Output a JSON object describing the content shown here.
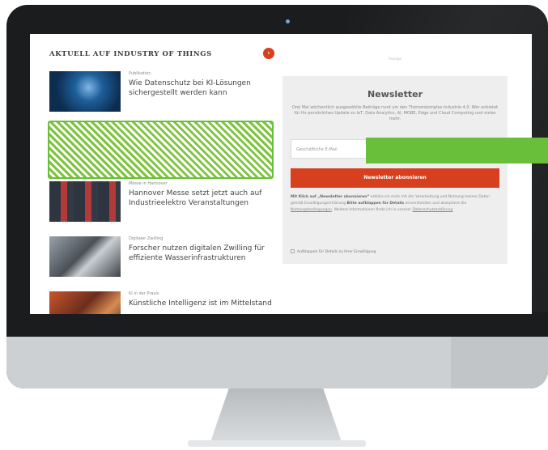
{
  "section": {
    "heading": "AKTUELL AUF INDUSTRY OF THINGS",
    "more_icon": "arrow-right-icon"
  },
  "articles": [
    {
      "category": "Publikation",
      "title": "Wie Datenschutz bei KI-Lösungen sichergestellt werden kann"
    },
    {
      "category": "Messe in Hannover",
      "title": "Hannover Messe setzt jetzt auch auf Industrieelektro Veranstaltungen"
    },
    {
      "category": "Digitaler Zwilling",
      "title": "Forscher nutzen digitalen Zwilling für effiziente Wasserinfrastrukturen"
    },
    {
      "category": "KI in der Praxis",
      "title": "Künstliche Intelligenz ist im Mittelstand"
    }
  ],
  "ad_label": "Anzeige",
  "newsletter": {
    "title": "Newsletter",
    "intro": "Drei Mal wöchentlich ausgewählte Beiträge rund um den Themenkomplex Industrie 4.0. Wer anbietet für Ihr persönliches Update zu IoT, Data Analytics, AI, MOBE, Edge und Cloud Computing und vieles mehr.",
    "email_placeholder": "Geschäftliche E-Mail",
    "subscribe_label": "Newsletter abonnieren",
    "legal_lead": "Mit Klick auf „Newsletter abonnieren“",
    "legal_body": "erkläre ich mich mit der Verarbeitung und Nutzung meiner Daten gemäß Einwilligungserklärung",
    "legal_expand": "Bitte aufklappen für Details",
    "legal_tail": "einverstanden und akzeptiere die",
    "privacy_link": "Nutzungsbedingungen",
    "legal_more": ". Weitere Informationen finde ich in unserer",
    "privacy_link2": "Datenschutzerklärung",
    "consent_label": "Aufklappen für Details zu Ihrer Einwilligung"
  }
}
